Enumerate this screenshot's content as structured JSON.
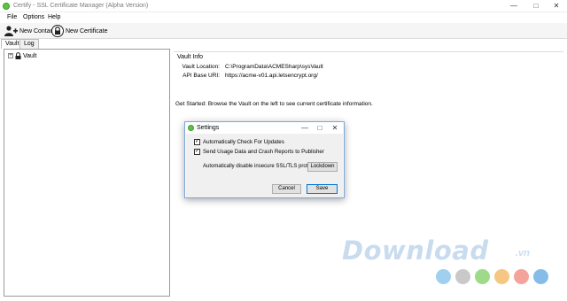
{
  "window": {
    "title": "Certify - SSL Certificate Manager (Alpha Version)"
  },
  "menu": [
    "File",
    "Options",
    "Help"
  ],
  "toolbar": {
    "new_contact": "New Contact",
    "new_certificate": "New Certificate"
  },
  "tabs": [
    "Vault",
    "Log"
  ],
  "tree": {
    "root_label": "Vault"
  },
  "vault_info": {
    "title": "Vault Info",
    "location_label": "Vault Location:",
    "location_value": "C:\\ProgramData\\ACMESharp\\sysVault",
    "api_label": "API Base URI:",
    "api_value": "https://acme-v01.api.letsencrypt.org/"
  },
  "get_started": "Get Started: Browse the Vault on the left to see current certificate information.",
  "settings_dialog": {
    "title": "Settings",
    "check_updates_label": "Automatically Check For Updates",
    "check_updates_checked": true,
    "send_usage_label": "Send Usage Data and Crash Reports to Publisher",
    "send_usage_checked": true,
    "ssl_text": "Automatically disable insecure SSL/TLS protocols:",
    "lockdown_label": "Lockdown",
    "cancel_label": "Cancel",
    "save_label": "Save"
  },
  "watermark": {
    "text": "Download",
    "tld": ".vn",
    "dot_colors": [
      "#9fd1ee",
      "#c9c9c9",
      "#9fd98a",
      "#f6c783",
      "#f4a39a",
      "#86bde8"
    ]
  }
}
